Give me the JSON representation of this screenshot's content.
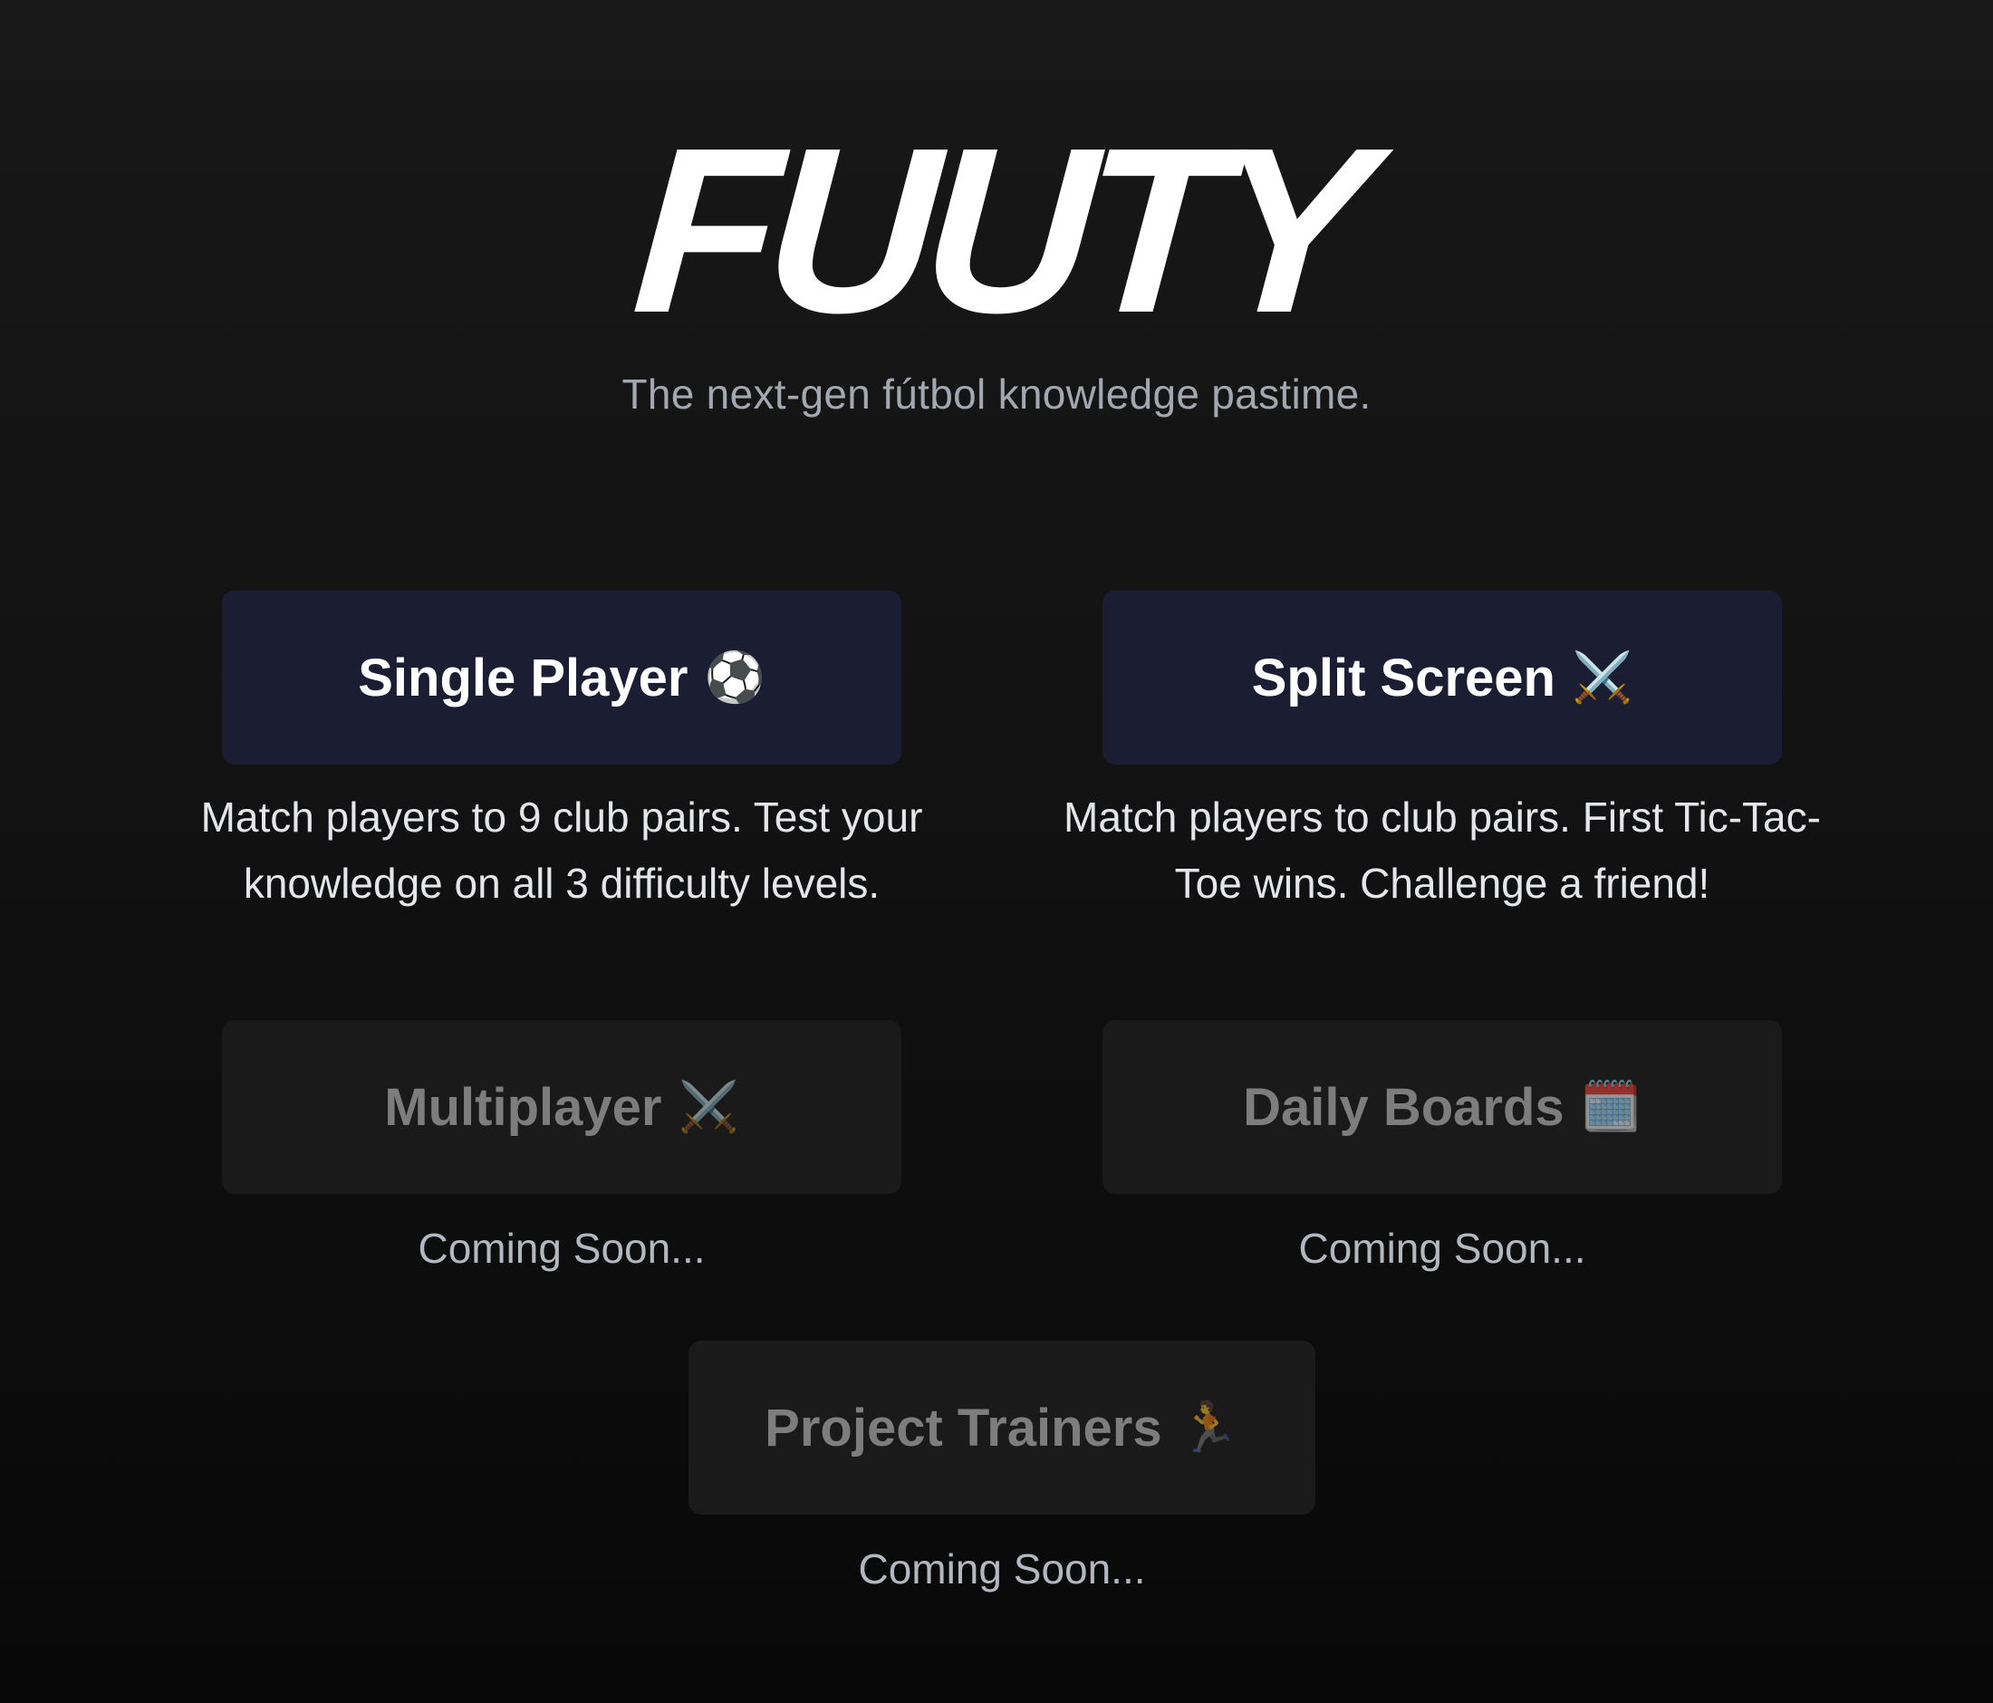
{
  "header": {
    "logo": "FUUTY",
    "tagline": "The next-gen fútbol knowledge pastime."
  },
  "modes": [
    {
      "label": "Single Player",
      "emoji": "⚽",
      "icon": "soccer-ball-icon",
      "description": "Match players to 9 club pairs. Test your knowledge on all 3 difficulty levels.",
      "enabled": true
    },
    {
      "label": "Split Screen",
      "emoji": "⚔️",
      "icon": "crossed-swords-icon",
      "description": "Match players to club pairs. First Tic-Tac-Toe wins. Challenge a friend!",
      "enabled": true
    },
    {
      "label": "Multiplayer",
      "emoji": "⚔️",
      "icon": "crossed-swords-icon",
      "description": "Coming Soon...",
      "enabled": false
    },
    {
      "label": "Daily Boards",
      "emoji": "🗓️",
      "icon": "spiral-calendar-icon",
      "description": "Coming Soon...",
      "enabled": false
    },
    {
      "label": "Project Trainers",
      "emoji": "🏃",
      "icon": "runner-icon",
      "description": "Coming Soon...",
      "enabled": false
    }
  ],
  "colors": {
    "background": "#121212",
    "active_button": "#1b1e32",
    "disabled_button": "#1a1a1a",
    "tagline": "#a3a7b0",
    "disabled_text": "#7d7d7d"
  }
}
